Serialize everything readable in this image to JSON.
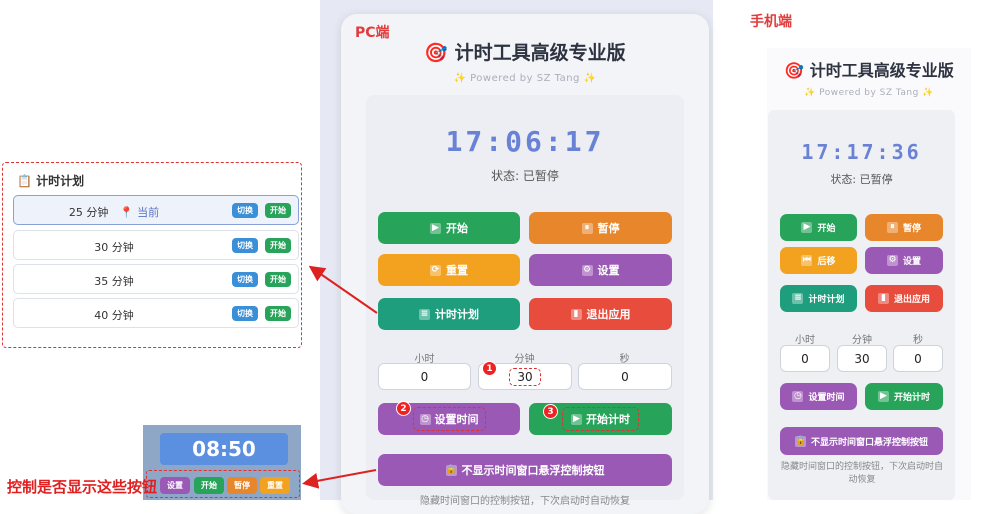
{
  "labels": {
    "pc": "PC端",
    "mobile": "手机端",
    "floating_control": "控制是否显示这些按钮"
  },
  "app": {
    "title": "计时工具高级专业版",
    "powered": "✨ Powered by SZ Tang ✨"
  },
  "pc": {
    "time": "17:06:17",
    "status": "状态: 已暂停",
    "buttons": {
      "start": "开始",
      "pause": "暂停",
      "reset": "重置",
      "settings": "设置",
      "plan": "计时计划",
      "exit": "退出应用"
    },
    "fields": {
      "hour_label": "小时",
      "hour_value": "0",
      "minute_label": "分钟",
      "minute_value": "30",
      "second_label": "秒",
      "second_value": "0"
    },
    "set_time": "设置时间",
    "start_timer": "开始计时",
    "hide_float": "不显示时间窗口悬浮控制按钮",
    "note": "隐藏时间窗口的控制按钮，下次启动时自动恢复",
    "badges": [
      "1",
      "2",
      "3"
    ]
  },
  "plan": {
    "title": "计时计划",
    "items": [
      {
        "duration": "25 分钟",
        "current": "当前",
        "switch": "切换",
        "start": "开始"
      },
      {
        "duration": "30 分钟",
        "switch": "切换",
        "start": "开始"
      },
      {
        "duration": "35 分钟",
        "switch": "切换",
        "start": "开始"
      },
      {
        "duration": "40 分钟",
        "switch": "切换",
        "start": "开始"
      }
    ]
  },
  "floating": {
    "time": "08:50",
    "buttons": [
      "设置",
      "开始",
      "暂停",
      "重置"
    ]
  },
  "mobile": {
    "time": "17:17:36",
    "status": "状态: 已暂停",
    "buttons": {
      "start": "开始",
      "pause": "暂停",
      "back": "后移",
      "settings": "设置",
      "plan": "计时计划",
      "exit": "退出应用"
    },
    "fields": {
      "hour_label": "小时",
      "hour_value": "0",
      "minute_label": "分钟",
      "minute_value": "30",
      "second_label": "秒",
      "second_value": "0"
    },
    "set_time": "设置时间",
    "start_timer": "开始计时",
    "hide_float": "不显示时间窗口悬浮控制按钮",
    "note": "隐藏时间窗口的控制按钮，下次启动时自动恢复"
  }
}
